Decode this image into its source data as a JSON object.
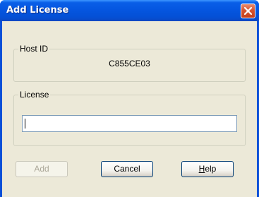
{
  "window": {
    "title": "Add License",
    "close_icon": "close-icon"
  },
  "host_id_group": {
    "label": "Host ID",
    "value": "C855CE03"
  },
  "license_group": {
    "label": "License",
    "input_value": ""
  },
  "buttons": {
    "add_label": "Add",
    "cancel_label": "Cancel",
    "help_mnemonic": "H",
    "help_rest": "elp"
  },
  "colors": {
    "titlebar": "#0556e0",
    "client": "#ece9d8",
    "close_button": "#d6532e"
  }
}
